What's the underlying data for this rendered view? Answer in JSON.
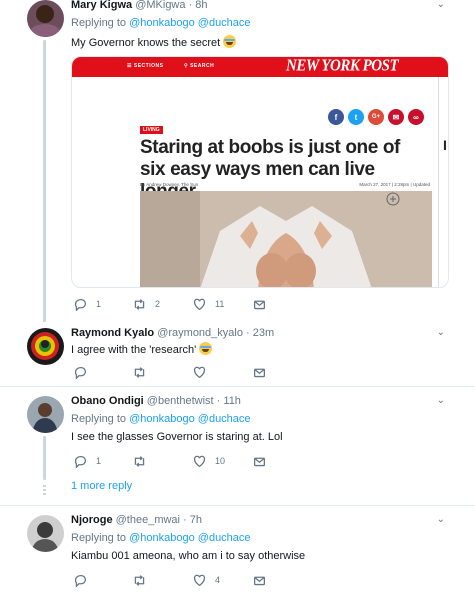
{
  "tweets": [
    {
      "name": "Mary Kigwa",
      "handle": "@MKigwa",
      "sep": "·",
      "time": "8h",
      "reply_prefix": "Replying to",
      "reply_to": [
        "@honkabogo",
        "@duchace"
      ],
      "text": "My Governor knows the secret",
      "counts": {
        "reply": "1",
        "retweet": "2",
        "like": "11"
      }
    },
    {
      "name": "Raymond Kyalo",
      "handle": "@raymond_kyalo",
      "sep": "·",
      "time": "23m",
      "text": "I agree with the 'research'",
      "counts": {
        "reply": "",
        "retweet": "",
        "like": ""
      }
    },
    {
      "name": "Obano Ondigi",
      "handle": "@benthetwist",
      "sep": "·",
      "time": "11h",
      "reply_prefix": "Replying to",
      "reply_to": [
        "@honkabogo",
        "@duchace"
      ],
      "text": "I see the glasses Governor is staring at. Lol",
      "counts": {
        "reply": "1",
        "retweet": "",
        "like": "10"
      }
    },
    {
      "name": "Njoroge",
      "handle": "@thee_mwai",
      "sep": "·",
      "time": "7h",
      "reply_prefix": "Replying to",
      "reply_to": [
        "@honkabogo",
        "@duchace"
      ],
      "text": "Kiambu 001 ameona, who am i to say otherwise",
      "counts": {
        "reply": "",
        "retweet": "",
        "like": "4"
      }
    }
  ],
  "more_replies": "1 more reply",
  "media": {
    "menu": "SECTIONS",
    "search": "SEARCH",
    "logo": "NEW YORK POST",
    "label": "LIVING",
    "headline": "Staring at boobs is just one of six easy ways men can live longer",
    "byline": "By Andrew Downey, The Sun",
    "date": "March 27, 2017 | 2:28pm | Updated",
    "side_letter": "I"
  },
  "colors": {
    "accent": "#1da1f2",
    "post_red": "#e0101b",
    "muted": "#657786"
  },
  "icons": [
    "reply-icon",
    "retweet-icon",
    "like-icon",
    "message-icon",
    "chevron-down-icon"
  ]
}
